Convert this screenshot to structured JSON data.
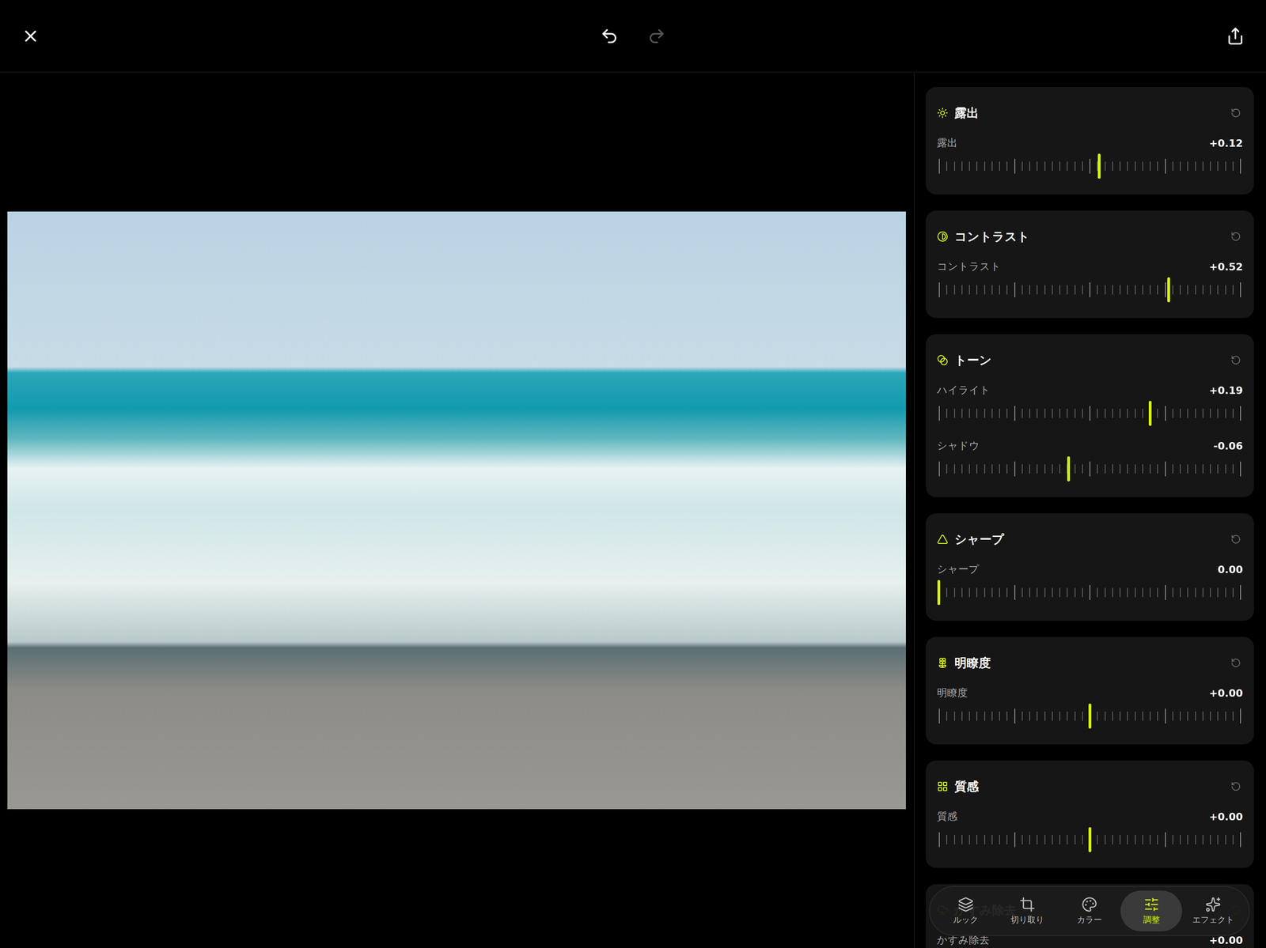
{
  "history": {
    "undo_enabled": true,
    "redo_enabled": false
  },
  "panels": [
    {
      "title": "露出",
      "sliders": [
        {
          "label": "露出",
          "value": "+0.12",
          "level": 0.53
        }
      ]
    },
    {
      "title": "コントラスト",
      "sliders": [
        {
          "label": "コントラスト",
          "value": "+0.52",
          "level": 0.76
        }
      ]
    },
    {
      "title": "トーン",
      "sliders": [
        {
          "label": "ハイライト",
          "value": "+0.19",
          "level": 0.7
        },
        {
          "label": "シャドウ",
          "value": "-0.06",
          "level": 0.43
        }
      ]
    },
    {
      "title": "シャープ",
      "sliders": [
        {
          "label": "シャープ",
          "value": "0.00",
          "level": 0
        }
      ]
    },
    {
      "title": "明瞭度",
      "sliders": [
        {
          "label": "明瞭度",
          "value": "+0.00",
          "level": 0.5
        }
      ]
    },
    {
      "title": "質感",
      "sliders": [
        {
          "label": "質感",
          "value": "+0.00",
          "level": 0.5
        }
      ]
    },
    {
      "title": "かすみ除去",
      "sliders": [
        {
          "label": "かすみ除去",
          "value": "+0.00",
          "level": 0.5
        }
      ]
    }
  ],
  "tabs": [
    {
      "label": "ルック",
      "selected": false
    },
    {
      "label": "切り取り",
      "selected": false
    },
    {
      "label": "カラー",
      "selected": false
    },
    {
      "label": "調整",
      "selected": true
    },
    {
      "label": "エフェクト",
      "selected": false
    }
  ]
}
